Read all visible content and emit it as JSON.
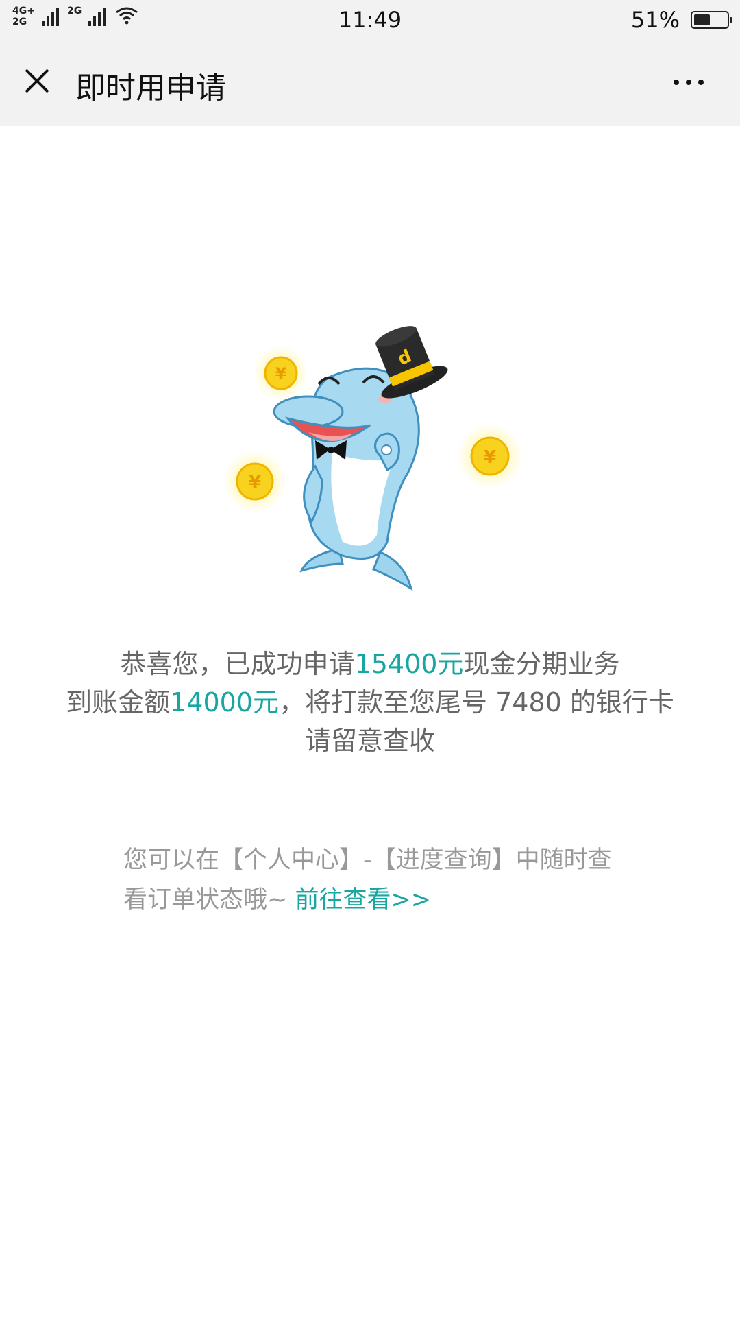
{
  "status_bar": {
    "network_1": "4G+",
    "network_1b": "2G",
    "network_2": "2G",
    "time": "11:49",
    "battery_percent": "51%",
    "battery_level": 0.51
  },
  "nav": {
    "title": "即时用申请",
    "close_icon": "close-icon",
    "more_icon": "more-icon"
  },
  "illustration": {
    "name": "dolphin-mascot",
    "coin_glyph": "¥",
    "hat_letter": "d"
  },
  "message": {
    "line1_prefix": "恭喜您，已成功申请",
    "line1_amount": "15400元",
    "line1_suffix": "现金分期业务",
    "line2_prefix": "到账金额",
    "line2_amount": "14000元",
    "line2_suffix": "，将打款至您尾号 7480 的银行卡",
    "line3": "请留意查收"
  },
  "hint": {
    "text": "您可以在【个人中心】-【进度查询】中随时查看订单状态哦~ ",
    "link_label": "前往查看>>"
  },
  "colors": {
    "accent": "#17a6a0",
    "text": "#666666",
    "hint": "#999999",
    "bar_bg": "#f2f2f2"
  }
}
